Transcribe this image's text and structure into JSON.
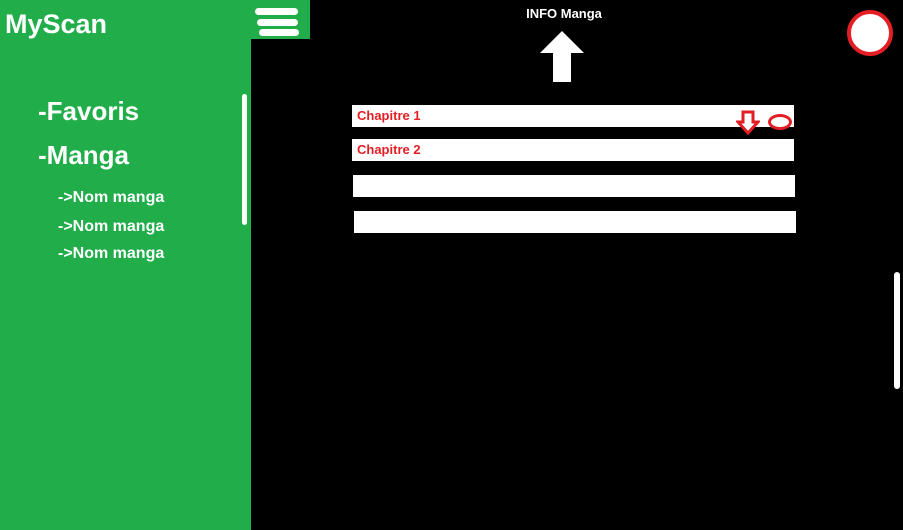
{
  "app": {
    "title": "MyScan"
  },
  "sidebar": {
    "items": [
      {
        "label": "-Favoris"
      },
      {
        "label": "-Manga"
      }
    ],
    "manga_items": [
      {
        "label": "->Nom manga"
      },
      {
        "label": "->Nom manga"
      },
      {
        "label": "->Nom manga"
      }
    ]
  },
  "header": {
    "title": "INFO Manga"
  },
  "chapters": [
    {
      "label": "Chapitre 1"
    },
    {
      "label": "Chapitre 2"
    },
    {
      "label": ""
    },
    {
      "label": ""
    }
  ],
  "icons": {
    "menu": "hamburger-menu-icon",
    "back": "up-arrow-icon",
    "download": "download-arrow-icon",
    "status": "ellipse-icon",
    "profile": "circle-avatar-icon"
  },
  "colors": {
    "sidebar_bg": "#22ad4b",
    "page_bg": "#000000",
    "accent_red": "#e31e24",
    "text_white": "#ffffff"
  }
}
